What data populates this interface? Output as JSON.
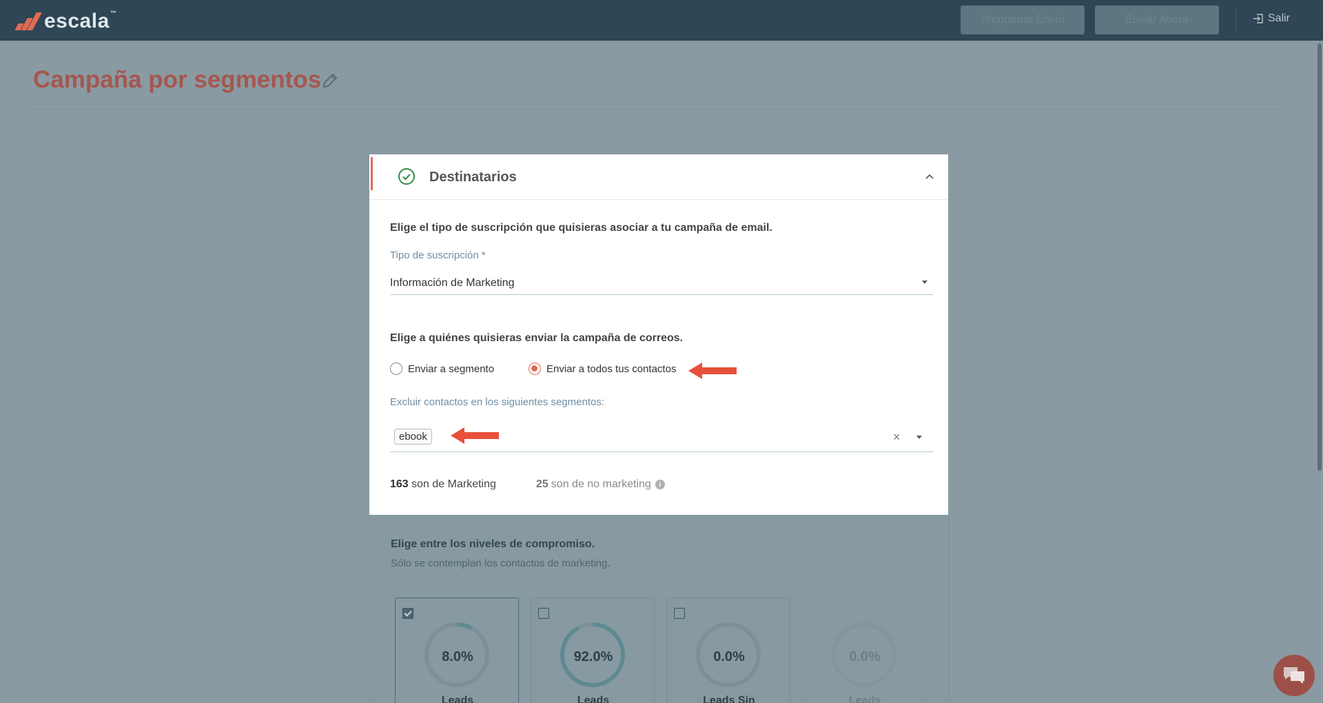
{
  "header": {
    "logo_text": "escala",
    "logo_tm": "™",
    "schedule_button": "Programar Envío",
    "send_now_button": "Enviar Ahora",
    "logout_label": "Salir"
  },
  "page": {
    "title": "Campaña por segmentos"
  },
  "recipients": {
    "title": "Destinatarios",
    "subscription_question": "Elige el tipo de suscripción que quisieras asociar a tu campaña de email.",
    "subscription_label": "Tipo de suscripción *",
    "subscription_value": "Información de Marketing",
    "audience_question": "Elige a quiénes quisieras enviar la campaña de correos.",
    "radio_segment": "Enviar a segmento",
    "radio_all": "Enviar a todos tus contactos",
    "selected_option": "Enviar a todos tus contactos",
    "exclude_label": "Excluir contactos en los siguientes segmentos:",
    "excluded_chips": [
      "ebook"
    ],
    "marketing_count": "163",
    "marketing_text": "son de Marketing",
    "non_marketing_count": "25",
    "non_marketing_text": "son de no marketing"
  },
  "engagement": {
    "title": "Elige entre los niveles de compromiso.",
    "subtitle": "Sólo se contemplan los contactos de marketing.",
    "levels": [
      {
        "percent_label": "8.0%",
        "value": 0.08,
        "checked": true,
        "label": "Leads"
      },
      {
        "percent_label": "92.0%",
        "value": 0.92,
        "checked": false,
        "label": "Leads"
      },
      {
        "percent_label": "0.0%",
        "value": 0.0,
        "checked": false,
        "label": "Leads Sin"
      },
      {
        "percent_label": "0.0%",
        "value": 0.0,
        "checked": false,
        "label": "Leads"
      }
    ]
  },
  "colors": {
    "topbar": "#2e4655",
    "accent": "#e06a55",
    "title": "#a5574f"
  }
}
